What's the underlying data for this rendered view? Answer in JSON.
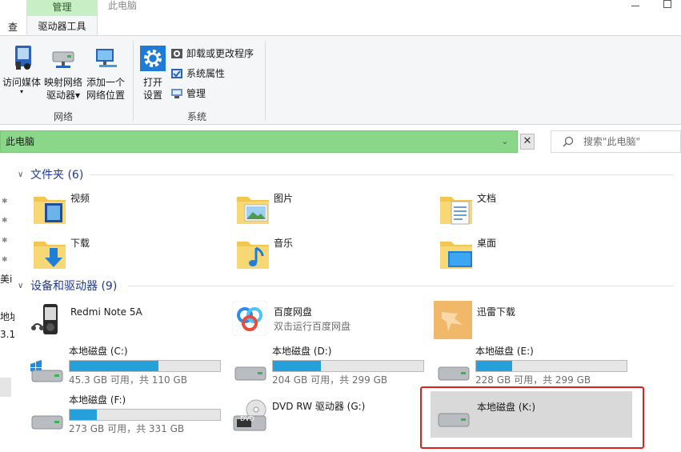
{
  "window": {
    "title": "此电脑",
    "tabs": {
      "manage": "管理",
      "drive_tools": "驱动器工具",
      "view_partial": "查看"
    }
  },
  "ribbon": {
    "network": {
      "label": "网络",
      "access_media": [
        "访问媒体",
        "▾"
      ],
      "map_drive": [
        "映射网络",
        "驱动器▾"
      ],
      "add_location": [
        "添加一个",
        "网络位置"
      ]
    },
    "system": {
      "label": "系统",
      "open_settings": [
        "打开",
        "设置"
      ],
      "uninstall": "卸载或更改程序",
      "properties": "系统属性",
      "manage": "管理"
    }
  },
  "address": {
    "path": "此电脑",
    "search_placeholder": "搜索\"此电脑\""
  },
  "nav": {
    "partial_1": "美i",
    "partial_2": "地址",
    "partial_3": "3.1"
  },
  "folders": {
    "header": "文件夹 (6)",
    "items": [
      "视频",
      "图片",
      "文档",
      "下载",
      "音乐",
      "桌面"
    ]
  },
  "devices": {
    "header": "设备和驱动器 (9)",
    "phone": "Redmi Note 5A",
    "baidu": {
      "name": "百度网盘",
      "sub": "双击运行百度网盘"
    },
    "xunlei": "迅雷下载",
    "drives": [
      {
        "name": "本地磁盘 (C:)",
        "info": "45.3 GB 可用，共 110 GB",
        "used_fraction": 0.59
      },
      {
        "name": "本地磁盘 (D:)",
        "info": "204 GB 可用，共 299 GB",
        "used_fraction": 0.32
      },
      {
        "name": "本地磁盘 (E:)",
        "info": "228 GB 可用，共 299 GB",
        "used_fraction": 0.24
      },
      {
        "name": "本地磁盘 (F:)",
        "info": "273 GB 可用，共 331 GB",
        "used_fraction": 0.18
      }
    ],
    "dvd": "DVD RW 驱动器 (G:)",
    "dvd_badge": "DVD",
    "drive_k": "本地磁盘 (K:)"
  },
  "colors": {
    "accent_green": "#8bd78a",
    "bar_fill": "#26a0da",
    "header_blue": "#1f3a93",
    "highlight_red": "#e01f1f"
  }
}
